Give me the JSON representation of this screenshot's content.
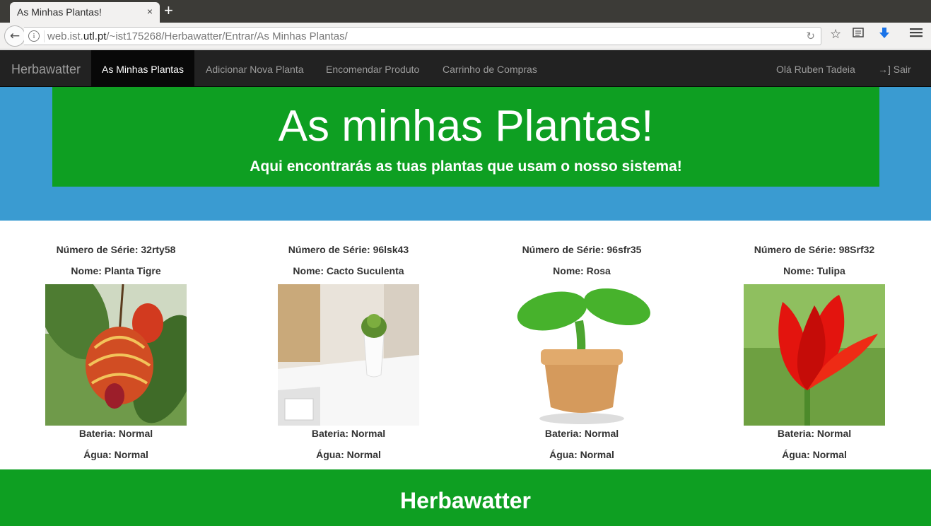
{
  "browser": {
    "tab_title": "As Minhas Plantas!",
    "tab_close": "×",
    "new_tab": "+",
    "url_prefix": "web.ist.",
    "url_domain": "utl.pt",
    "url_path": "/~ist175268/Herbawatter/Entrar/As Minhas Plantas/"
  },
  "navbar": {
    "brand": "Herbawatter",
    "items": [
      {
        "label": "As Minhas Plantas",
        "active": true
      },
      {
        "label": "Adicionar Nova Planta"
      },
      {
        "label": "Encomendar Produto"
      },
      {
        "label": "Carrinho de Compras"
      }
    ],
    "user_greeting": "Olá Ruben Tadeia",
    "logout": "Sair"
  },
  "hero": {
    "title": "As minhas Plantas!",
    "subtitle": "Aqui encontrarás as tuas plantas que usam o nosso sistema!"
  },
  "plants": [
    {
      "serie": "Número de Série: 32rty58",
      "nome": "Nome: Planta Tigre",
      "bateria": "Bateria: Normal",
      "agua": "Água: Normal",
      "image": "flowering-maple-photo"
    },
    {
      "serie": "Número de Série: 96lsk43",
      "nome": "Nome: Cacto Suculenta",
      "bateria": "Bateria: Normal",
      "agua": "Água: Normal",
      "image": "succulent-pot-photo"
    },
    {
      "serie": "Número de Série: 96sfr35",
      "nome": "Nome: Rosa",
      "bateria": "Bateria: Normal",
      "agua": "Água: Normal",
      "image": "sprout-pot-illustration"
    },
    {
      "serie": "Número de Série: 98Srf32",
      "nome": "Nome: Tulipa",
      "bateria": "Bateria: Normal",
      "agua": "Água: Normal",
      "image": "red-tulip-photo"
    }
  ],
  "footer": {
    "title": "Herbawatter"
  },
  "colors": {
    "hero_bg": "#3a9bd1",
    "hero_box": "#0e9f22",
    "footer_bg": "#0e9f22",
    "navbar_bg": "#222222"
  }
}
